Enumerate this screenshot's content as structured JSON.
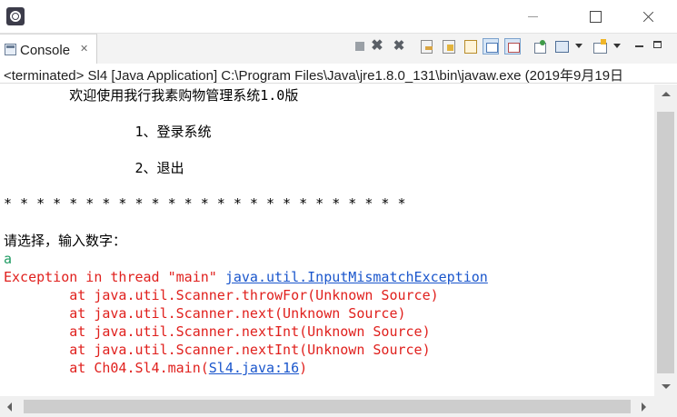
{
  "window": {
    "icon": "eclipse-icon",
    "controls": [
      "minimize-icon",
      "maximize-icon",
      "close-icon"
    ]
  },
  "tab": {
    "label": "Console",
    "close_glyph": "✕",
    "icon": "console-icon"
  },
  "toolbar": {
    "icons": [
      "terminate-icon",
      "remove-launch-icon",
      "remove-all-terminated-icon",
      "clear-console-icon",
      "scroll-lock-icon",
      "word-wrap-icon",
      "show-on-stdout-icon",
      "show-on-stderr-icon",
      "pin-console-icon",
      "display-console-icon",
      "open-console-icon",
      "minimize-view-icon",
      "maximize-view-icon"
    ],
    "remove_glyph": "✖",
    "remove_all_glyph": "✖"
  },
  "status": {
    "text": "<terminated> Sl4 [Java Application] C:\\Program Files\\Java\\jre1.8.0_131\\bin\\javaw.exe (2019年9月19日"
  },
  "console": {
    "welcome": "        欢迎使用我行我素购物管理系统1.0版",
    "option1": "                1、登录系统",
    "option2": "                2、退出",
    "stars": "* * * * * * * * * * * * * * * * * * * * * * * * *",
    "prompt": "请选择，输入数字：",
    "input": "a",
    "exception_prefix": "Exception in thread \"main\" ",
    "exception_link": "java.util.InputMismatchException",
    "trace1": "        at java.util.Scanner.throwFor(Unknown Source)",
    "trace2": "        at java.util.Scanner.next(Unknown Source)",
    "trace3": "        at java.util.Scanner.nextInt(Unknown Source)",
    "trace4": "        at java.util.Scanner.nextInt(Unknown Source)",
    "trace5_prefix": "        at Ch04.Sl4.main(",
    "trace5_link": "Sl4.java:16",
    "trace5_suffix": ")"
  },
  "colors": {
    "stdout": "#000000",
    "stdin": "#1e9b62",
    "stderr": "#e0201d",
    "link": "#1a56cc"
  }
}
